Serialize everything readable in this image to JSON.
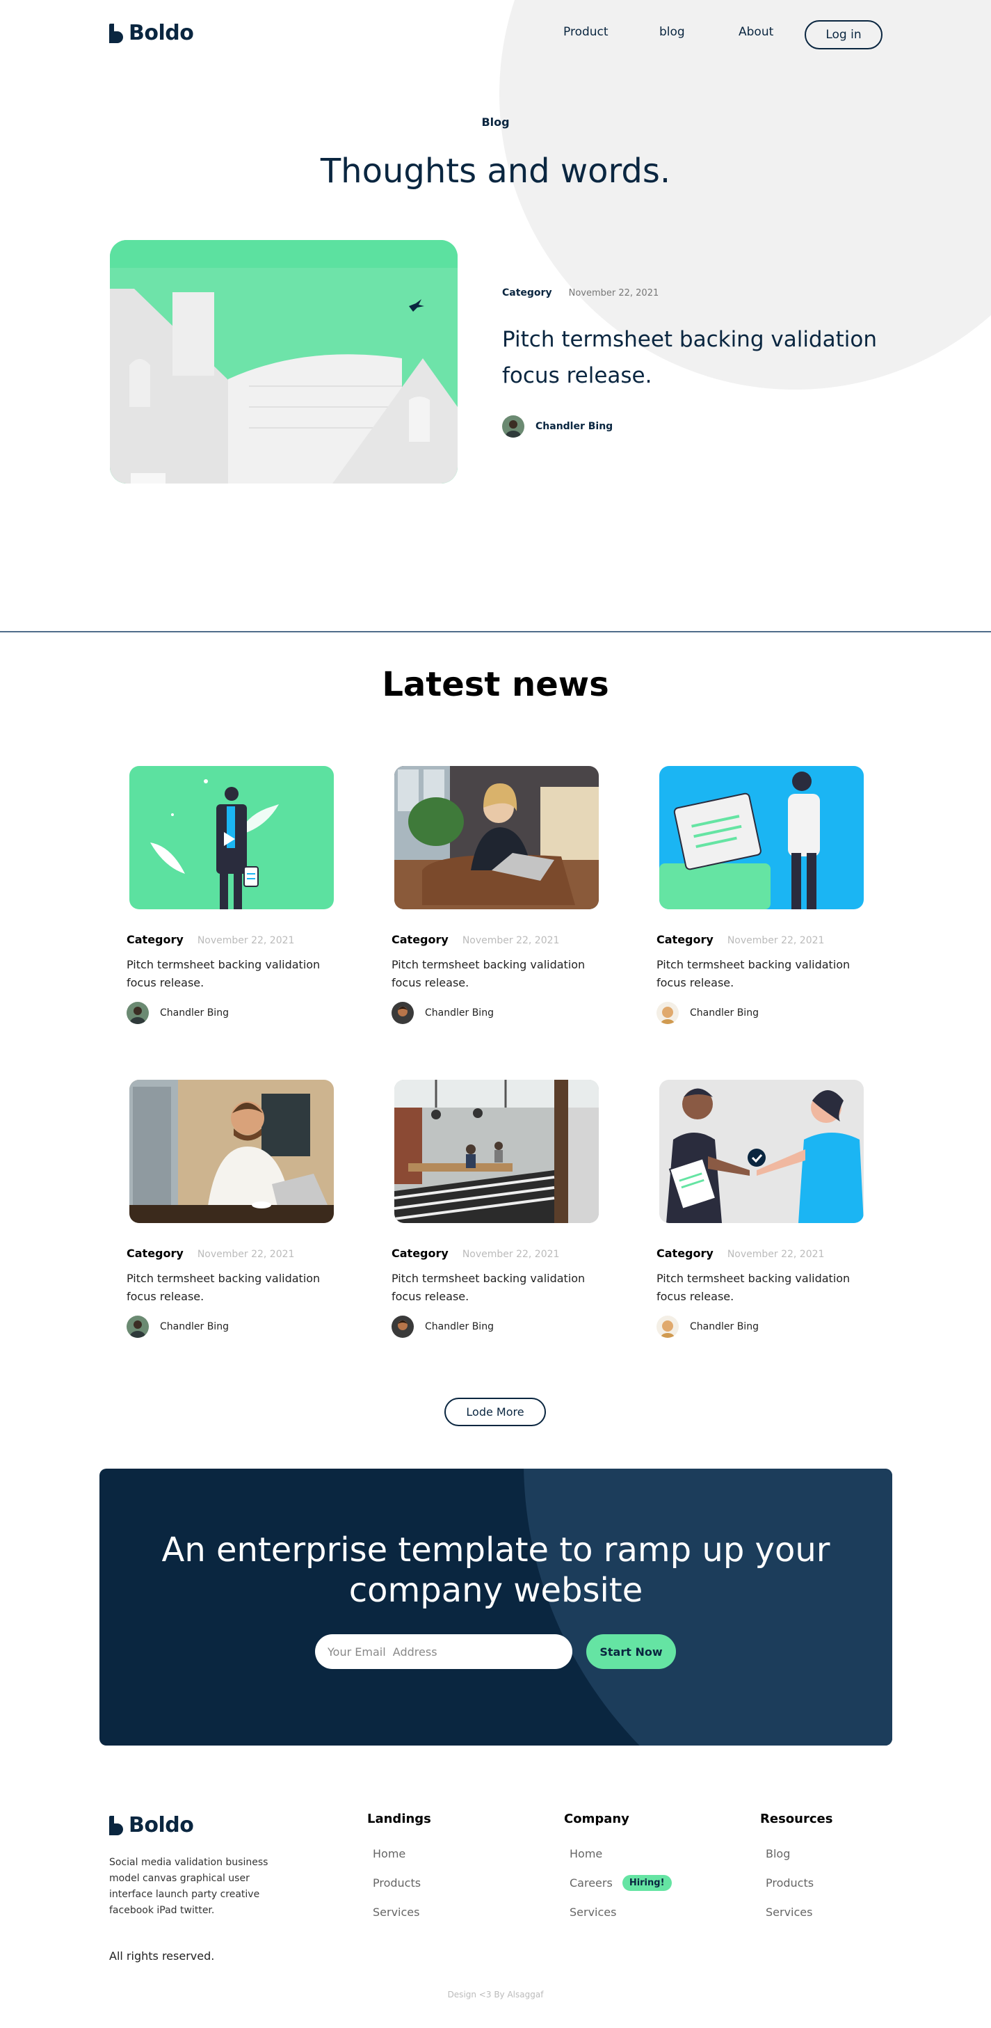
{
  "header": {
    "brand": "Boldo",
    "nav": [
      "Product",
      "blog",
      "About"
    ],
    "login": "Log in"
  },
  "hero": {
    "eyebrow": "Blog",
    "title": "Thoughts and words."
  },
  "featured": {
    "category": "Category",
    "date": "November 22, 2021",
    "title": "Pitch termsheet backing validation focus release.",
    "author": "Chandler Bing"
  },
  "latest": {
    "title": "Latest news",
    "cards": [
      {
        "category": "Category",
        "date": "November 22, 2021",
        "title": "Pitch termsheet backing validation focus release.",
        "author": "Chandler Bing",
        "image": "man-phone-illustration"
      },
      {
        "category": "Category",
        "date": "November 22, 2021",
        "title": "Pitch termsheet backing validation focus release.",
        "author": "Chandler Bing",
        "image": "woman-laptop-photo"
      },
      {
        "category": "Category",
        "date": "November 22, 2021",
        "title": "Pitch termsheet backing validation focus release.",
        "author": "Chandler Bing",
        "image": "documents-illustration"
      },
      {
        "category": "Category",
        "date": "November 22, 2021",
        "title": "Pitch termsheet backing validation focus release.",
        "author": "Chandler Bing",
        "image": "man-phone-photo"
      },
      {
        "category": "Category",
        "date": "November 22, 2021",
        "title": "Pitch termsheet backing validation focus release.",
        "author": "Chandler Bing",
        "image": "office-photo"
      },
      {
        "category": "Category",
        "date": "November 22, 2021",
        "title": "Pitch termsheet backing validation focus release.",
        "author": "Chandler Bing",
        "image": "handshake-illustration"
      }
    ],
    "load_more": "Lode More"
  },
  "cta": {
    "title": "An enterprise template to ramp up your company website",
    "email_placeholder": "Your Email  Address",
    "button": "Start Now"
  },
  "footer": {
    "brand": "Boldo",
    "description": "Social media validation business model canvas graphical user interface launch party creative facebook iPad twitter.",
    "rights": "All rights reserved.",
    "columns": [
      {
        "title": "Landings",
        "links": [
          "Home",
          "Products",
          "Services"
        ]
      },
      {
        "title": "Company",
        "links": [
          "Home",
          "Careers",
          "Services"
        ],
        "badge": "Hiring!"
      },
      {
        "title": "Resources",
        "links": [
          "Blog",
          "Products",
          "Services"
        ]
      }
    ],
    "credit": "Design <3 By Alsaggaf"
  },
  "colors": {
    "navy": "#0a2640",
    "mint": "#65e4a3",
    "sky": "#1bb5f3"
  }
}
